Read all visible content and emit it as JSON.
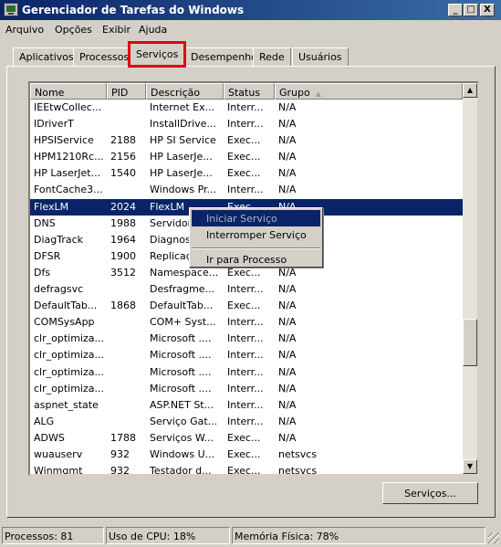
{
  "window": {
    "title": "Gerenciador de Tarefas do Windows",
    "min_glyph": "_",
    "max_glyph": "□",
    "close_glyph": "X"
  },
  "menubar": [
    {
      "label": "Arquivo"
    },
    {
      "label": "Opções"
    },
    {
      "label": "Exibir"
    },
    {
      "label": "Ajuda"
    }
  ],
  "tabs": [
    {
      "label": "Aplicativos"
    },
    {
      "label": "Processos"
    },
    {
      "label": "Serviços",
      "active": true
    },
    {
      "label": "Desempenho"
    },
    {
      "label": "Rede"
    },
    {
      "label": "Usuários"
    }
  ],
  "table": {
    "columns": [
      "Nome",
      "PID",
      "Descrição",
      "Status",
      "Grupo"
    ],
    "sort_indicator": "▲",
    "rows": [
      [
        "IEEtwCollec...",
        "",
        "Internet Ex...",
        "Interr...",
        "N/A"
      ],
      [
        "IDriverT",
        "",
        "InstallDrive...",
        "Interr...",
        "N/A"
      ],
      [
        "HPSIService",
        "2188",
        "HP SI Service",
        "Exec...",
        "N/A"
      ],
      [
        "HPM1210Rc...",
        "2156",
        "HP LaserJe...",
        "Exec...",
        "N/A"
      ],
      [
        "HP LaserJet...",
        "1540",
        "HP LaserJe...",
        "Exec...",
        "N/A"
      ],
      [
        "FontCache3...",
        "",
        "Windows Pr...",
        "Interr...",
        "N/A"
      ],
      [
        "FlexLM",
        "2024",
        "FlexLM",
        "Exec...",
        "N/A"
      ],
      [
        "DNS",
        "1988",
        "Servidor DNS",
        "Exec...",
        "N/A"
      ],
      [
        "DiagTrack",
        "1964",
        "Diagnostic...",
        "Exec...",
        "N/A"
      ],
      [
        "DFSR",
        "1900",
        "Replicação...",
        "Exec...",
        "N/A"
      ],
      [
        "Dfs",
        "3512",
        "Namespace...",
        "Exec...",
        "N/A"
      ],
      [
        "defragsvc",
        "",
        "Desfragme...",
        "Interr...",
        "N/A"
      ],
      [
        "DefaultTab...",
        "1868",
        "DefaultTab...",
        "Exec...",
        "N/A"
      ],
      [
        "COMSysApp",
        "",
        "COM+ Syst...",
        "Interr...",
        "N/A"
      ],
      [
        "clr_optimiza...",
        "",
        "Microsoft ....",
        "Interr...",
        "N/A"
      ],
      [
        "clr_optimiza...",
        "",
        "Microsoft ....",
        "Interr...",
        "N/A"
      ],
      [
        "clr_optimiza...",
        "",
        "Microsoft ....",
        "Interr...",
        "N/A"
      ],
      [
        "clr_optimiza...",
        "",
        "Microsoft ....",
        "Interr...",
        "N/A"
      ],
      [
        "aspnet_state",
        "",
        "ASP.NET St...",
        "Interr...",
        "N/A"
      ],
      [
        "ALG",
        "",
        "Serviço Gat...",
        "Interr...",
        "N/A"
      ],
      [
        "ADWS",
        "1788",
        "Serviços W...",
        "Exec...",
        "N/A"
      ],
      [
        "wuauserv",
        "932",
        "Windows U...",
        "Exec...",
        "netsvcs"
      ],
      [
        "Winmgmt",
        "932",
        "Testador d...",
        "Exec...",
        "netsvcs"
      ]
    ],
    "selected_row": 6,
    "scroll_up_glyph": "▲",
    "scroll_down_glyph": "▼"
  },
  "context_menu": [
    {
      "label": "Iniciar Serviço",
      "disabled": true
    },
    {
      "label": "Interromper Serviço"
    },
    {
      "label": "Ir para Processo"
    }
  ],
  "services_button": "Serviços...",
  "status": {
    "processes": "Processos: 81",
    "cpu": "Uso de CPU: 18%",
    "memory": "Memória Física: 78%"
  }
}
